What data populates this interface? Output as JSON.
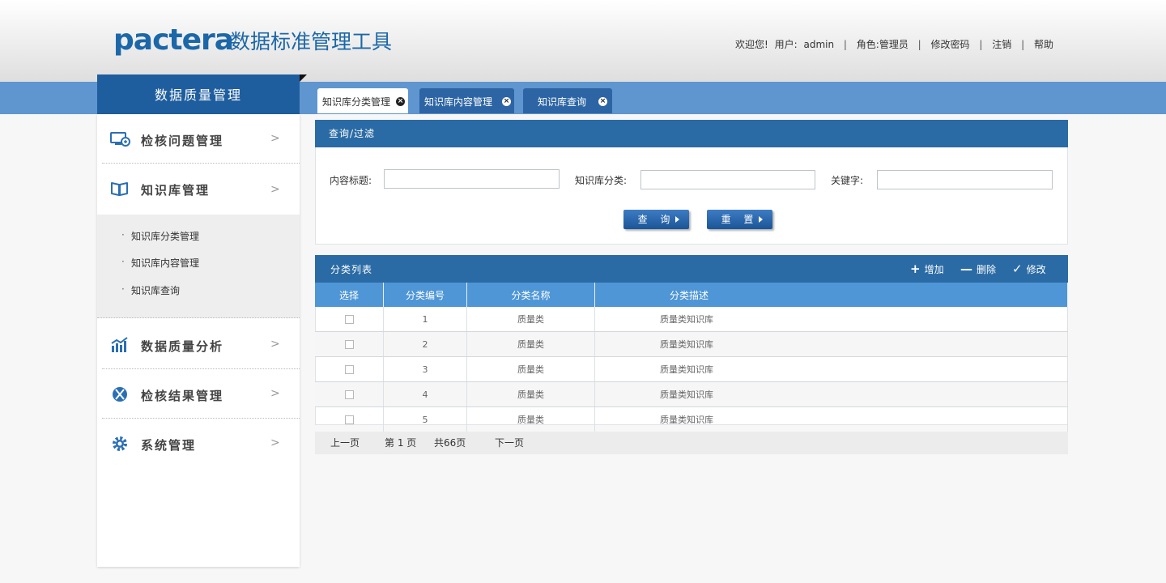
{
  "header": {
    "logo": "pactera",
    "title": "数据标准管理工具",
    "welcome": "欢迎您!",
    "user_label": "用户:",
    "user_name": "admin",
    "role_label": "角色:管理员",
    "change_password": "修改密码",
    "logout": "注销",
    "help": "帮助"
  },
  "sidebar": {
    "title": "数据质量管理",
    "items": [
      {
        "label": "检核问题管理",
        "icon": "monitor-icon"
      },
      {
        "label": "知识库管理",
        "icon": "book-icon"
      },
      {
        "label": "数据质量分析",
        "icon": "bar-chart-icon"
      },
      {
        "label": "检核结果管理",
        "icon": "xbox-icon"
      },
      {
        "label": "系统管理",
        "icon": "gear-icon"
      }
    ],
    "submenu": [
      "知识库分类管理",
      "知识库内容管理",
      "知识库查询"
    ]
  },
  "tabs": [
    {
      "label": "知识库分类管理",
      "active": true
    },
    {
      "label": "知识库内容管理",
      "active": false
    },
    {
      "label": "知识库查询",
      "active": false
    }
  ],
  "query": {
    "title": "查询/过滤",
    "content_title_label": "内容标题:",
    "content_title_value": "",
    "category_label": "知识库分类:",
    "category_value": "",
    "keyword_label": "关键字:",
    "keyword_value": "",
    "search_button": "查 询",
    "reset_button": "重 置"
  },
  "list": {
    "title": "分类列表",
    "add": "增加",
    "delete": "删除",
    "edit": "修改",
    "columns": [
      "选择",
      "分类编号",
      "分类名称",
      "分类描述"
    ],
    "rows": [
      {
        "id": "1",
        "name": "质量类",
        "desc": "质量类知识库"
      },
      {
        "id": "2",
        "name": "质量类",
        "desc": "质量类知识库"
      },
      {
        "id": "3",
        "name": "质量类",
        "desc": "质量类知识库"
      },
      {
        "id": "4",
        "name": "质量类",
        "desc": "质量类知识库"
      },
      {
        "id": "5",
        "name": "质量类",
        "desc": "质量类知识库"
      }
    ]
  },
  "pager": {
    "prev": "上一页",
    "current": "第 1 页",
    "total": "共66页",
    "next": "下一页"
  },
  "colors": {
    "brand": "#1b67a8",
    "nav": "#5f96cf",
    "panel_head": "#2b6ba5",
    "table_head": "#4f96d6"
  }
}
